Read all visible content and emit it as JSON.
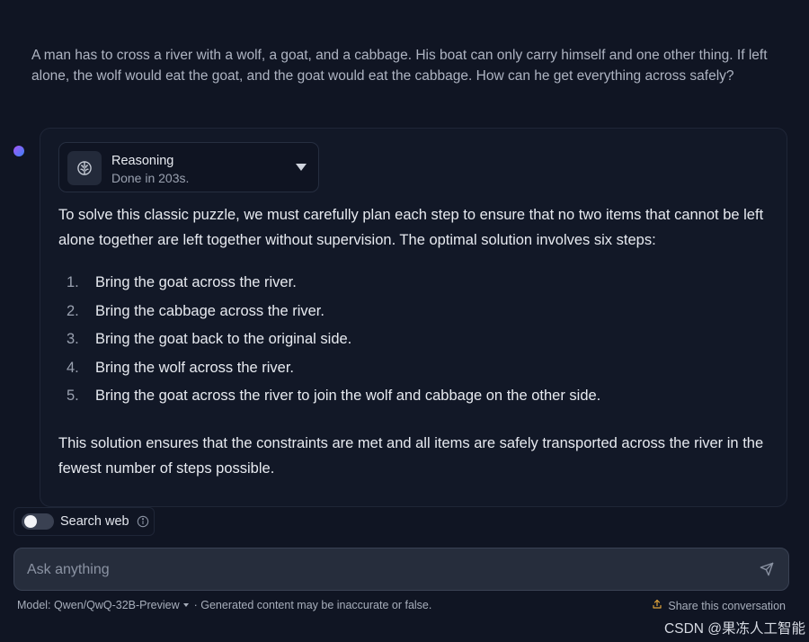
{
  "user_message": "A man has to cross a river with a wolf, a goat, and a cabbage. His boat can only carry himself and one other thing. If left alone, the wolf would eat the goat, and the goat would eat the cabbage. How can he get everything across safely?",
  "reasoning": {
    "title": "Reasoning",
    "status": "Done in 203s.",
    "icon": "brain-icon"
  },
  "answer": {
    "intro": "To solve this classic puzzle, we must carefully plan each step to ensure that no two items that cannot be left alone together are left together without supervision. The optimal solution involves six steps:",
    "steps": [
      {
        "num": "1.",
        "text": "Bring the goat across the river."
      },
      {
        "num": "2.",
        "text": "Bring the cabbage across the river."
      },
      {
        "num": "3.",
        "text": "Bring the goat back to the original side."
      },
      {
        "num": "4.",
        "text": "Bring the wolf across the river."
      },
      {
        "num": "5.",
        "text": "Bring the goat across the river to join the wolf and cabbage on the other side."
      }
    ],
    "conclusion": "This solution ensures that the constraints are met and all items are safely transported across the river in the fewest number of steps possible."
  },
  "search_web": {
    "label": "Search web",
    "enabled": false,
    "icon": "info-icon"
  },
  "composer": {
    "placeholder": "Ask anything",
    "value": "",
    "send_icon": "send-icon"
  },
  "footer": {
    "model_label": "Model: Qwen/QwQ-32B-Preview",
    "disclaimer": "· Generated content may be inaccurate or false.",
    "share_label": "Share this conversation",
    "share_icon": "share-icon"
  },
  "watermark": "CSDN @果冻人工智能",
  "colors": {
    "background": "#101523",
    "card": "#121827",
    "input": "#262d3c",
    "accent_gradient_start": "#a855f7",
    "accent_gradient_end": "#3b82f6"
  }
}
